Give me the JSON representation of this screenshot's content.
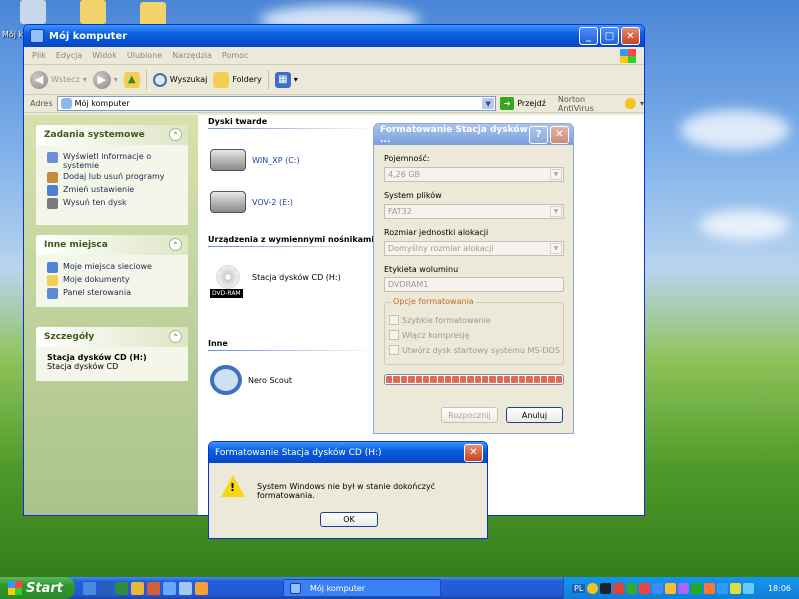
{
  "desktop": {
    "icon_label": "Mój k"
  },
  "window": {
    "title": "Mój komputer",
    "menu": [
      "Plik",
      "Edycja",
      "Widok",
      "Ulubione",
      "Narzędzia",
      "Pomoc"
    ],
    "toolbar": {
      "back_label": "Wstecz",
      "search_label": "Wyszukaj",
      "folders_label": "Foldery"
    },
    "address": {
      "label": "Adres",
      "value": "Mój komputer",
      "go_label": "Przejdź",
      "norton_label": "Norton AntiVirus"
    }
  },
  "left_pane": {
    "system_tasks": {
      "title": "Zadania systemowe",
      "items": [
        "Wyświetl informacje o systemie",
        "Dodaj lub usuń programy",
        "Zmień ustawienie",
        "Wysuń ten dysk"
      ]
    },
    "other_places": {
      "title": "Inne miejsca",
      "items": [
        "Moje miejsca sieciowe",
        "Moje dokumenty",
        "Panel sterowania"
      ]
    },
    "details": {
      "title": "Szczegóły",
      "name": "Stacja dysków CD (H:)",
      "type": "Stacja dysków CD"
    }
  },
  "content": {
    "hard_drives_header": "Dyski twarde",
    "drives": [
      "WIN_XP (C:)",
      "VOV-2 (E:)"
    ],
    "removable_header": "Urządzenia z wymiennymi nośnikami",
    "cd_drive": "Stacja dysków CD (H:)",
    "cd_badge": "DVD-RAM",
    "other_header": "Inne",
    "other_item": "Nero Scout"
  },
  "format_dialog": {
    "title": "Formatowanie Stacja dysków ...",
    "capacity_label": "Pojemność:",
    "capacity_value": "4,26 GB",
    "fs_label": "System plików",
    "fs_value": "FAT32",
    "alloc_label": "Rozmiar jednostki alokacji",
    "alloc_value": "Domyślny rozmiar alokacji",
    "volume_label": "Etykieta woluminu",
    "volume_value": "DVDRAM1",
    "options_title": "Opcje formatowania",
    "options": [
      "Szybkie formatowanie",
      "Włącz kompresję",
      "Utwórz dysk startowy systemu MS-DOS"
    ],
    "progress_fraction": 1.0,
    "start_btn": "Rozpocznij",
    "cancel_btn": "Anuluj"
  },
  "error_dialog": {
    "title": "Formatowanie Stacja dysków CD (H:)",
    "message": "System Windows nie był w stanie dokończyć formatowania.",
    "ok_btn": "OK"
  },
  "taskbar": {
    "start_label": "Start",
    "task_label": "Mój komputer",
    "lang": "PL",
    "clock": "18:06"
  }
}
